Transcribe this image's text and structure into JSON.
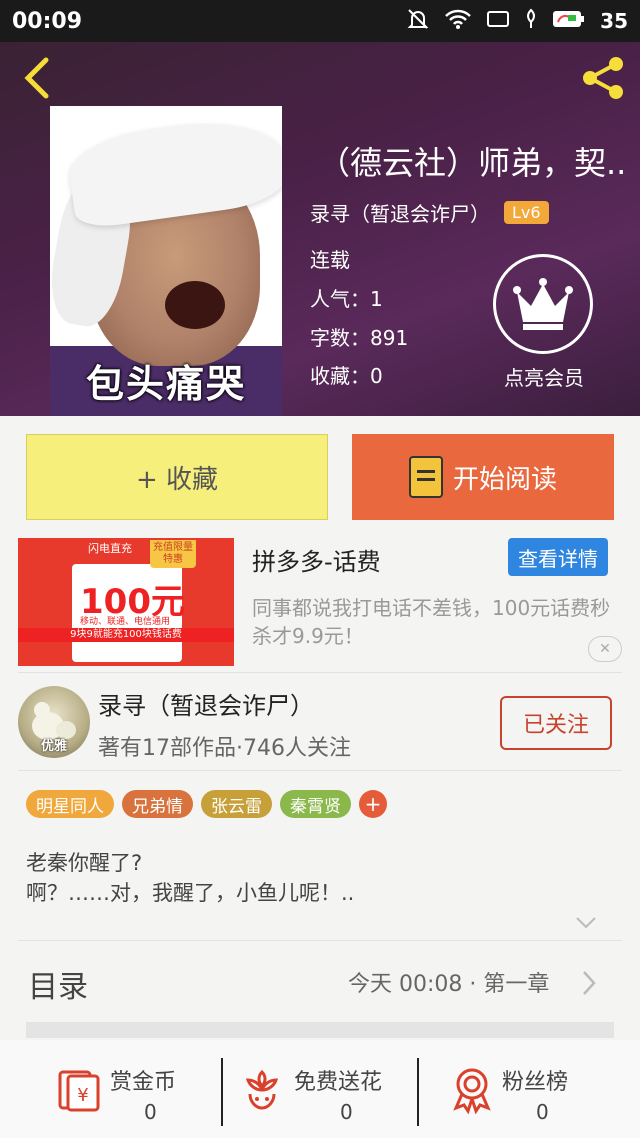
{
  "status_bar": {
    "time": "00:09",
    "battery": "35"
  },
  "book": {
    "title": "（德云社）师弟，契..",
    "cover_caption": "包头痛哭",
    "author": "录寻（暂退会诈尸）",
    "level": "Lv6",
    "status": "连载",
    "popularity_label": "人气：",
    "popularity": "1",
    "words_label": "字数：",
    "words": "891",
    "favorites_label": "收藏：",
    "favorites": "0",
    "vip_label": "点亮会员"
  },
  "actions": {
    "collect_label": "+ 收藏",
    "read_label": "开始阅读"
  },
  "ad": {
    "title": "拼多多-话费",
    "detail_button": "查看详情",
    "description": "同事都说我打电话不差钱，100元话费秒杀才9.9元！",
    "image_brand": "闪电直充",
    "image_tag": "充值限量特惠",
    "image_price": "100元",
    "image_sub": "移动、联通、电信通用",
    "image_band": "9块9就能充100块钱话费",
    "close_symbol": "✕"
  },
  "author_card": {
    "name": "录寻（暂退会诈尸）",
    "stats": "著有17部作品·746人关注",
    "avatar_badge": "优雅",
    "follow_label": "已关注"
  },
  "tags": [
    {
      "label": "明星同人",
      "color": "#f0a83c"
    },
    {
      "label": "兄弟情",
      "color": "#d9733e"
    },
    {
      "label": "张云雷",
      "color": "#c8a03a"
    },
    {
      "label": "秦霄贤",
      "color": "#8bb84a"
    }
  ],
  "tag_add_symbol": "+",
  "intro": {
    "line1": "老秦你醒了?",
    "line2": "啊？……对，我醒了，小鱼儿呢！.."
  },
  "toc": {
    "label": "目录",
    "latest": "今天 00:08 · 第一章"
  },
  "bottom_bar": {
    "reward": {
      "label": "赏金币",
      "value": "0"
    },
    "flower": {
      "label": "免费送花",
      "value": "0"
    },
    "fans": {
      "label": "粉丝榜",
      "value": "0"
    }
  },
  "colors": {
    "accent": "#e9683e",
    "collect_bg": "#f7ef7b",
    "follow": "#c8432e",
    "ad_button": "#2f86e0",
    "icon_red": "#d9412c"
  }
}
